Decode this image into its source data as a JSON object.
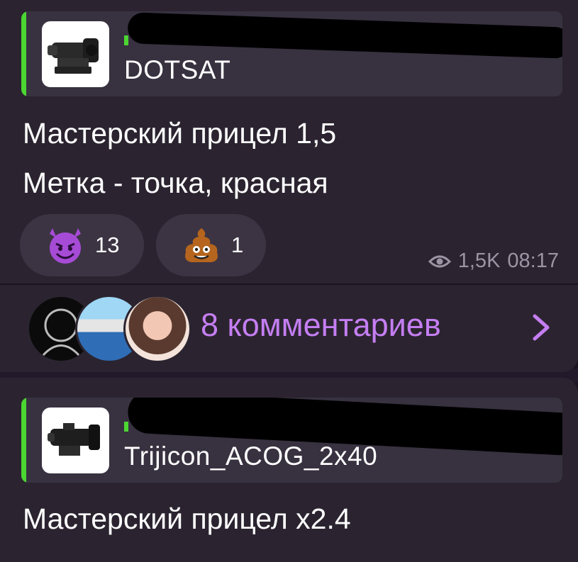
{
  "posts": [
    {
      "reply": {
        "sender": "",
        "text": "DOTSAT",
        "thumbnail_icon": "scope-icon"
      },
      "text_lines": [
        "Мастерский прицел 1,5",
        "Метка - точка, красная"
      ],
      "reactions": [
        {
          "emoji": "smiling-devil-emoji",
          "count": "13"
        },
        {
          "emoji": "poop-emoji",
          "count": "1"
        }
      ],
      "views": "1,5K",
      "time": "08:17",
      "comments_label": "8 комментариев",
      "colors": {
        "accent": "#4bd632",
        "link": "#c57ef2"
      }
    },
    {
      "reply": {
        "sender": "",
        "text": "Trijicon_ACOG_2x40",
        "thumbnail_icon": "acog-scope-icon"
      },
      "text_lines": [
        "Мастерский прицел x2.4"
      ]
    }
  ]
}
